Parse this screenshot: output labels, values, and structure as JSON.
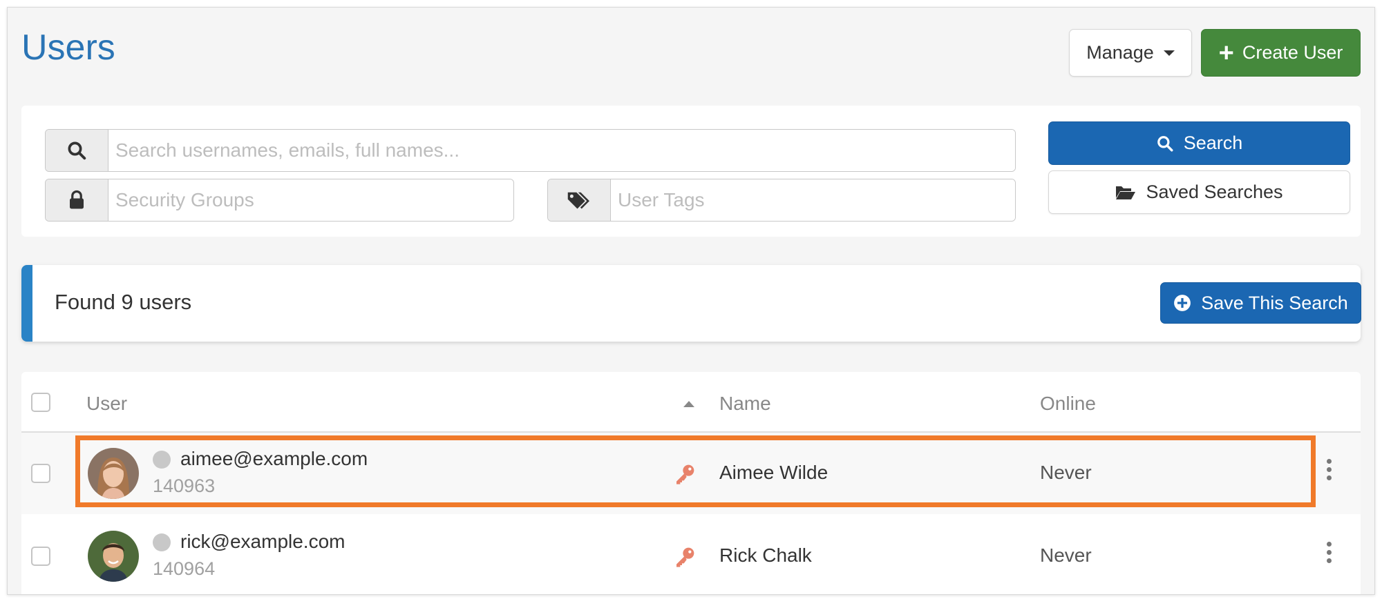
{
  "header": {
    "title": "Users",
    "manage_label": "Manage",
    "create_user_label": "Create User"
  },
  "search": {
    "main_placeholder": "Search usernames, emails, full names...",
    "security_groups_placeholder": "Security Groups",
    "user_tags_placeholder": "User Tags",
    "search_label": "Search",
    "saved_searches_label": "Saved Searches"
  },
  "results": {
    "found_text": "Found 9 users",
    "save_search_label": "Save This Search"
  },
  "table": {
    "columns": [
      "User",
      "Name",
      "Online"
    ],
    "sort_column": "User",
    "sort_direction": "ascending",
    "rows": [
      {
        "email": "aimee@example.com",
        "id": "140963",
        "name": "Aimee Wilde",
        "online": "Never",
        "highlighted": true,
        "avatar": "avatar-woman-icon"
      },
      {
        "email": "rick@example.com",
        "id": "140964",
        "name": "Rick Chalk",
        "online": "Never",
        "highlighted": false,
        "avatar": "avatar-man-icon"
      }
    ]
  },
  "colors": {
    "title": "#2a74b5",
    "primary": "#1b67b2",
    "success": "#45893c",
    "accent_bar": "#2a83c6",
    "highlight": "#f07a2a",
    "key_icon": "#e8826a"
  }
}
